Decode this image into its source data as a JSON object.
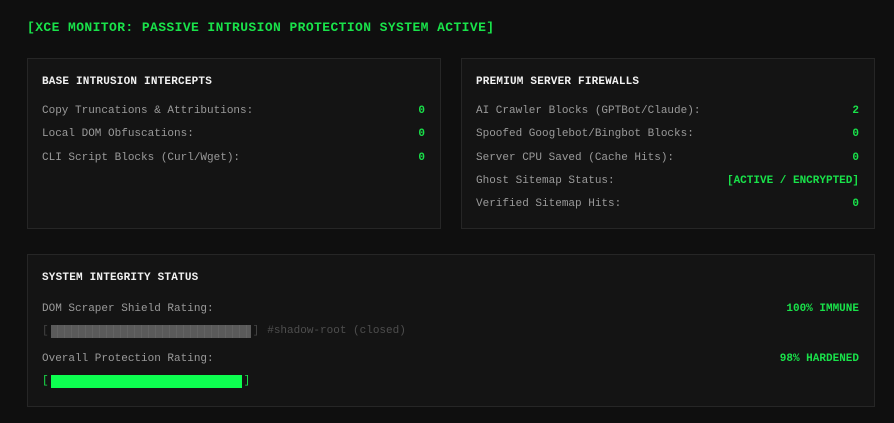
{
  "header": {
    "title": "[XCE MONITOR: PASSIVE INTRUSION PROTECTION SYSTEM ACTIVE]"
  },
  "base_panel": {
    "title": "BASE INTRUSION INTERCEPTS",
    "rows": [
      {
        "label": "Copy Truncations & Attributions:",
        "value": "0"
      },
      {
        "label": "Local DOM Obfuscations:",
        "value": "0"
      },
      {
        "label": "CLI Script Blocks (Curl/Wget):",
        "value": "0"
      }
    ]
  },
  "premium_panel": {
    "title": "PREMIUM SERVER FIREWALLS",
    "rows": [
      {
        "label": "AI Crawler Blocks (GPTBot/Claude):",
        "value": "2"
      },
      {
        "label": "Spoofed Googlebot/Bingbot Blocks:",
        "value": "0"
      },
      {
        "label": "Server CPU Saved (Cache Hits):",
        "value": "0"
      },
      {
        "label": "Ghost Sitemap Status:",
        "value": "[ACTIVE / ENCRYPTED]"
      },
      {
        "label": "Verified Sitemap Hits:",
        "value": "0"
      }
    ]
  },
  "integrity_panel": {
    "title": "SYSTEM INTEGRITY STATUS",
    "shield": {
      "label": "DOM Scraper Shield Rating:",
      "value": "100% IMMUNE",
      "bar_open": "[",
      "bar_close": "]",
      "level": 1.0,
      "note": "#shadow-root (closed)"
    },
    "overall": {
      "label": "Overall Protection Rating:",
      "value": "98% HARDENED",
      "bar_open": "[",
      "bar_close": "]",
      "level": 0.98
    }
  },
  "colors": {
    "accent_green": "#19e24a",
    "bar_green": "#0dff50",
    "bar_grey": "#5a5a5a",
    "background": "#0f0f0f",
    "panel_background": "#141414"
  }
}
